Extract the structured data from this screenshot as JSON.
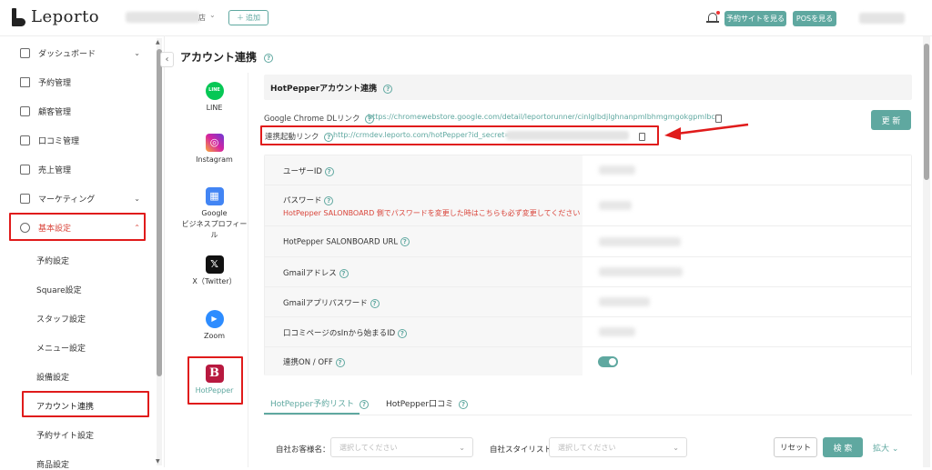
{
  "header": {
    "logo_text": "Leporto",
    "store_suffix": "店",
    "store_caret": "⌄",
    "add_label": "追加",
    "reserve_site_label": "予約サイトを見る",
    "pos_label": "POSを見る"
  },
  "sidebar": {
    "items": [
      {
        "label": "ダッシュボード",
        "icon": "dashboard-icon",
        "chevron": "⌄"
      },
      {
        "label": "予約管理",
        "icon": "list-icon"
      },
      {
        "label": "顧客管理",
        "icon": "customer-icon"
      },
      {
        "label": "口コミ管理",
        "icon": "comment-icon"
      },
      {
        "label": "売上管理",
        "icon": "chart-icon"
      },
      {
        "label": "マーケティング",
        "icon": "marketing-icon",
        "chevron": "⌄"
      },
      {
        "label": "基本設定",
        "icon": "gear-icon",
        "chevron": "⌃",
        "active": true
      }
    ],
    "subitems": [
      "予約設定",
      "Square設定",
      "スタッフ設定",
      "メニュー設定",
      "設備設定",
      "アカウント連携",
      "予約サイト設定",
      "商品設定"
    ],
    "active_subitem": "アカウント連携",
    "collapse_icon": "‹"
  },
  "page": {
    "title": "アカウント連携",
    "help_glyph": "?"
  },
  "integrations": [
    {
      "label": "LINE",
      "icon": "line-icon",
      "color": "#06c755",
      "glyph": "LINE"
    },
    {
      "label": "Instagram",
      "icon": "instagram-icon",
      "color": "#d6249f",
      "glyph": "◎"
    },
    {
      "label": "Google\nビジネスプロフィール",
      "icon": "google-business-icon",
      "color": "#4285f4",
      "glyph": "▦"
    },
    {
      "label": "X（Twitter）",
      "icon": "x-twitter-icon",
      "color": "#111111",
      "glyph": "𝕏"
    },
    {
      "label": "Zoom",
      "icon": "zoom-icon",
      "color": "#2d8cff",
      "glyph": "▶"
    },
    {
      "label": "HotPepper",
      "icon": "hotpepper-icon",
      "color": "#b8193f",
      "glyph": "B",
      "active": true
    }
  ],
  "panel": {
    "title": "HotPepperアカウント連携",
    "chrome_label": "Google Chrome DLリンク",
    "chrome_link": "https://chromewebstore.google.com/detail/leportorunner/cinlglbdjlghnanpmlbhmgmgokgpmlbc",
    "update_label": "更 新",
    "launch_label": "連携起動リンク",
    "launch_link": "http://crmdev.leporto.com/hotPepper?id_secret=",
    "rows": [
      {
        "label": "ユーザーID"
      },
      {
        "label": "パスワード",
        "warning": "HotPepper SALONBOARD 側でパスワードを変更した時はこちらも必ず変更してください"
      },
      {
        "label": "HotPepper SALONBOARD URL"
      },
      {
        "label": "Gmailアドレス"
      },
      {
        "label": "Gmailアプリパスワード"
      },
      {
        "label": "口コミページのsInから始まるID"
      },
      {
        "label": "連携ON / OFF",
        "toggle": true
      }
    ],
    "toggle_on": true
  },
  "tabs": [
    {
      "label": "HotPepper予約リスト",
      "active": true
    },
    {
      "label": "HotPepper口コミ",
      "active": false
    }
  ],
  "filters": {
    "customer_label": "自社お客様名：",
    "customer_placeholder": "選択してください",
    "stylist_label": "自社スタイリスト：",
    "stylist_placeholder": "選択してください",
    "reset_label": "リセット",
    "search_label": "検 索",
    "expand_label": "拡大",
    "expand_caret": "⌄"
  },
  "colors": {
    "accent": "#5fa8a0",
    "highlight": "#e01b1b",
    "warning": "#d9453b"
  }
}
